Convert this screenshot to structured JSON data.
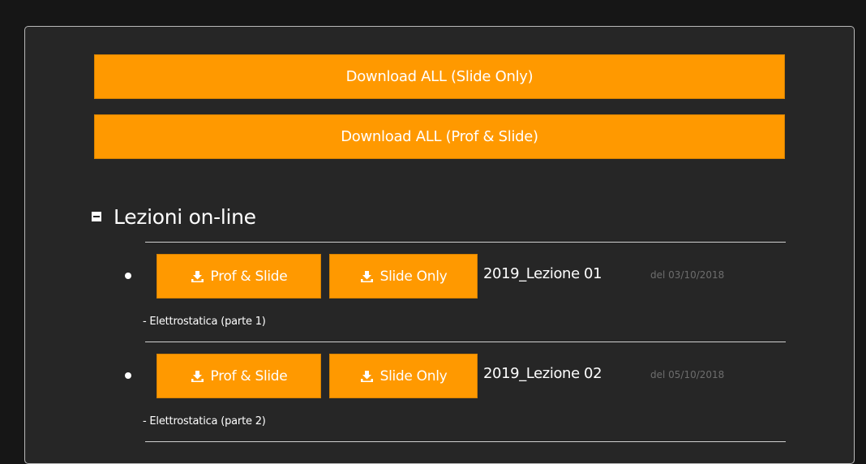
{
  "download_all": {
    "slide_only_label": "Download ALL (Slide Only)",
    "prof_slide_label": "Download ALL (Prof & Slide)"
  },
  "section": {
    "title": "Lezioni on-line",
    "toggle_icon": "collapse-minus-icon"
  },
  "lessons": [
    {
      "prof_label": "Prof & Slide",
      "slide_label": "Slide Only",
      "name": "2019_Lezione 01",
      "date": "del 03/10/2018",
      "description": "- Elettrostatica (parte 1)"
    },
    {
      "prof_label": "Prof & Slide",
      "slide_label": "Slide Only",
      "name": "2019_Lezione 02",
      "date": "del 05/10/2018",
      "description": "- Elettrostatica (parte 2)"
    }
  ],
  "colors": {
    "background": "#161616",
    "panel": "#262626",
    "accent": "#ff9900",
    "muted_text": "#6d6d6d"
  },
  "icons": {
    "download": "download-icon"
  }
}
